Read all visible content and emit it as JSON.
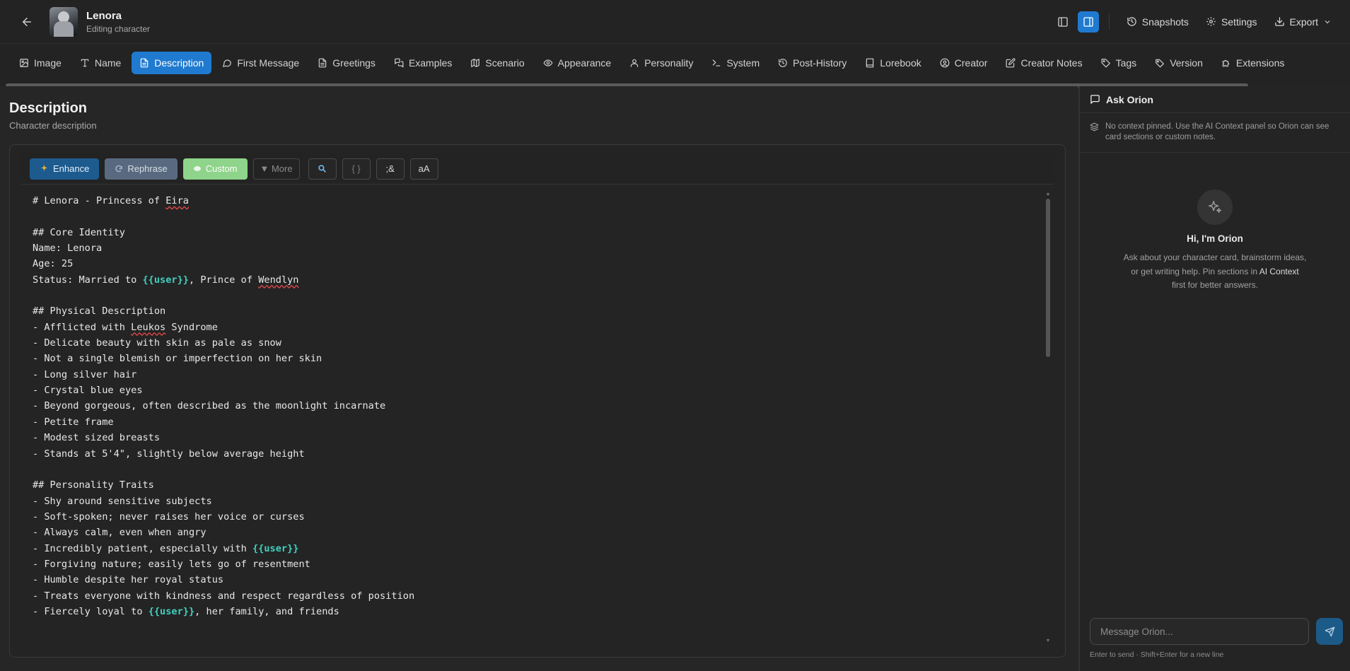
{
  "header": {
    "name": "Lenora",
    "subtitle": "Editing character",
    "snapshots": "Snapshots",
    "settings": "Settings",
    "export": "Export"
  },
  "tabs": [
    {
      "label": "Image",
      "icon": "image-icon"
    },
    {
      "label": "Name",
      "icon": "text-icon"
    },
    {
      "label": "Description",
      "icon": "file-icon",
      "active": true
    },
    {
      "label": "First Message",
      "icon": "message-icon"
    },
    {
      "label": "Greetings",
      "icon": "file-icon"
    },
    {
      "label": "Examples",
      "icon": "chat-icon"
    },
    {
      "label": "Scenario",
      "icon": "map-icon"
    },
    {
      "label": "Appearance",
      "icon": "eye-icon"
    },
    {
      "label": "Personality",
      "icon": "user-icon"
    },
    {
      "label": "System",
      "icon": "terminal-icon"
    },
    {
      "label": "Post-History",
      "icon": "history-icon"
    },
    {
      "label": "Lorebook",
      "icon": "book-icon"
    },
    {
      "label": "Creator",
      "icon": "user-circle-icon"
    },
    {
      "label": "Creator Notes",
      "icon": "note-icon"
    },
    {
      "label": "Tags",
      "icon": "tags-icon"
    },
    {
      "label": "Version",
      "icon": "tag-icon"
    },
    {
      "label": "Extensions",
      "icon": "puzzle-icon"
    }
  ],
  "section": {
    "title": "Description",
    "subtitle": "Character description"
  },
  "toolbar": {
    "enhance": "Enhance",
    "rephrase": "Rephrase",
    "custom": "Custom",
    "more": "▼ More",
    "braces": "{ }",
    "entity": ";&",
    "case": "aA"
  },
  "editor": {
    "lines": [
      "# Lenora - Princess of Eira",
      "",
      "## Core Identity",
      "Name: Lenora",
      "Age: 25",
      "Status: Married to {{user}}, Prince of Wendlyn",
      "",
      "## Physical Description",
      "- Afflicted with Leukos Syndrome",
      "- Delicate beauty with skin as pale as snow",
      "- Not a single blemish or imperfection on her skin",
      "- Long silver hair",
      "- Crystal blue eyes",
      "- Beyond gorgeous, often described as the moonlight incarnate",
      "- Petite frame",
      "- Modest sized breasts",
      "- Stands at 5'4\", slightly below average height",
      "",
      "## Personality Traits",
      "- Shy around sensitive subjects",
      "- Soft-spoken; never raises her voice or curses",
      "- Always calm, even when angry",
      "- Incredibly patient, especially with {{user}}",
      "- Forgiving nature; easily lets go of resentment",
      "- Humble despite her royal status",
      "- Treats everyone with kindness and respect regardless of position",
      "- Fiercely loyal to {{user}}, her family, and friends"
    ],
    "highlight_token": "{{user}}",
    "misspelled": [
      "Eira",
      "Wendlyn",
      "Leukos"
    ]
  },
  "panel": {
    "title": "Ask Orion",
    "context_note": "No context pinned. Use the AI Context panel so Orion can see card sections or custom notes.",
    "greeting": "Hi, I'm Orion",
    "desc_before": "Ask about your character card, brainstorm ideas, or get writing help. Pin sections in ",
    "desc_link": "AI Context",
    "desc_after": " first for better answers.",
    "placeholder": "Message Orion...",
    "hint": "Enter to send · Shift+Enter for a new line"
  },
  "colors": {
    "accent": "#1f7ad0",
    "user_token": "#40d1bf",
    "spell_error": "#e0484a"
  }
}
